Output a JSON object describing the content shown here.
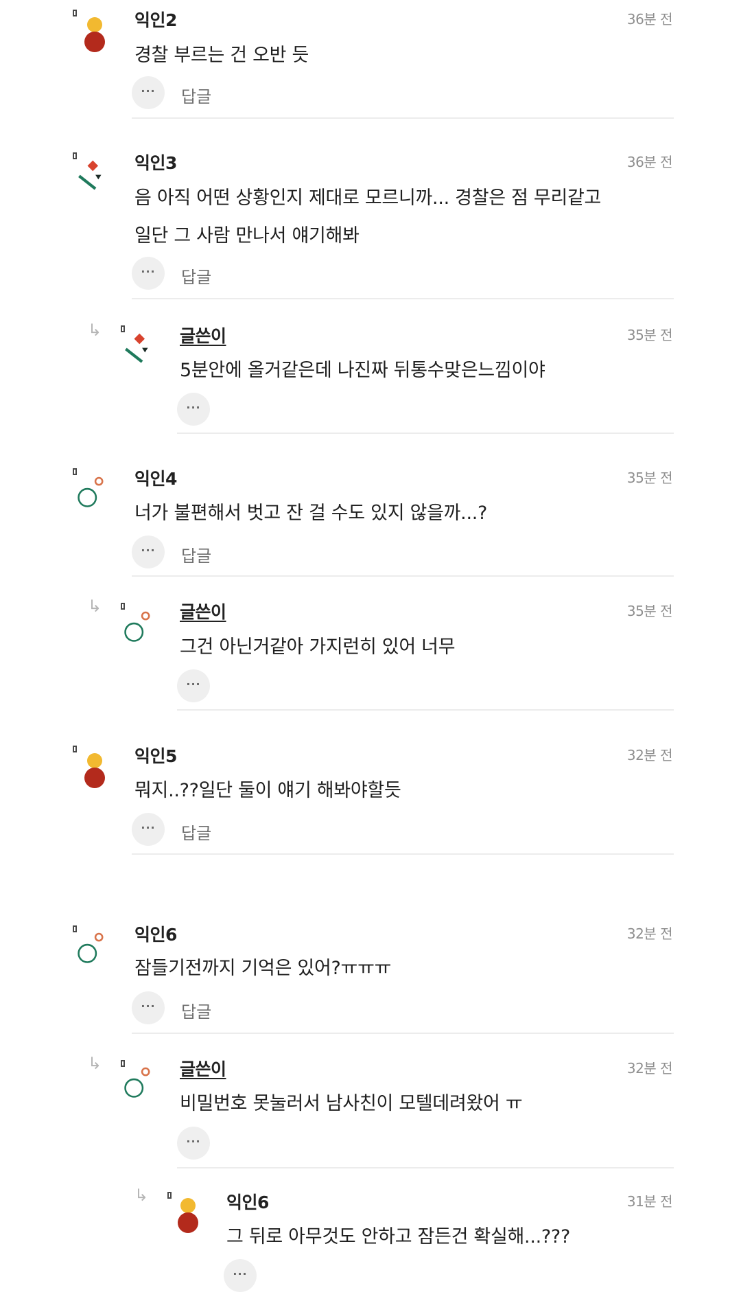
{
  "reply_label": "답글",
  "more_icon_text": "···",
  "reply_arrow_icon": "↳",
  "comments": [
    {
      "author": "익인2",
      "time": "36분 전",
      "lines": [
        "경찰 부르는 건 오반 듯"
      ]
    },
    {
      "author": "익인3",
      "time": "36분 전",
      "lines": [
        "음 아직 어떤 상황인지 제대로 모르니까... 경찰은 점 무리같고",
        "일단 그 사람 만나서 얘기해봐"
      ]
    },
    {
      "author": "글쓴이",
      "time": "35분 전",
      "lines": [
        "5분안에 올거같은데 나진짜 뒤통수맞은느낌이야"
      ]
    },
    {
      "author": "익인4",
      "time": "35분 전",
      "lines": [
        "너가 불편해서 벗고 잔 걸 수도 있지 않을까...?"
      ]
    },
    {
      "author": "글쓴이",
      "time": "35분 전",
      "lines": [
        "그건 아닌거같아 가지런히 있어 너무"
      ]
    },
    {
      "author": "익인5",
      "time": "32분 전",
      "lines": [
        "뭐지..??일단 둘이 얘기 해봐야할듯"
      ]
    },
    {
      "author": "익인6",
      "time": "32분 전",
      "lines": [
        "잠들기전까지 기억은 있어?ㅠㅠㅠ"
      ]
    },
    {
      "author": "글쓴이",
      "time": "32분 전",
      "lines": [
        "비밀번호 못눌러서 남사친이 모텔데려왔어 ㅠ"
      ]
    },
    {
      "author": "익인6",
      "time": "31분 전",
      "lines": [
        "그 뒤로 아무것도 안하고 잠든건 확실해...???"
      ]
    }
  ],
  "colors": {
    "avatar_yellow": "#f2b930",
    "avatar_red": "#b32a1c",
    "avatar_green": "#1f7a5c",
    "avatar_orange": "#d8734a",
    "avatar_diamond_red": "#d8432e",
    "avatar_dark": "#1c2b26"
  }
}
